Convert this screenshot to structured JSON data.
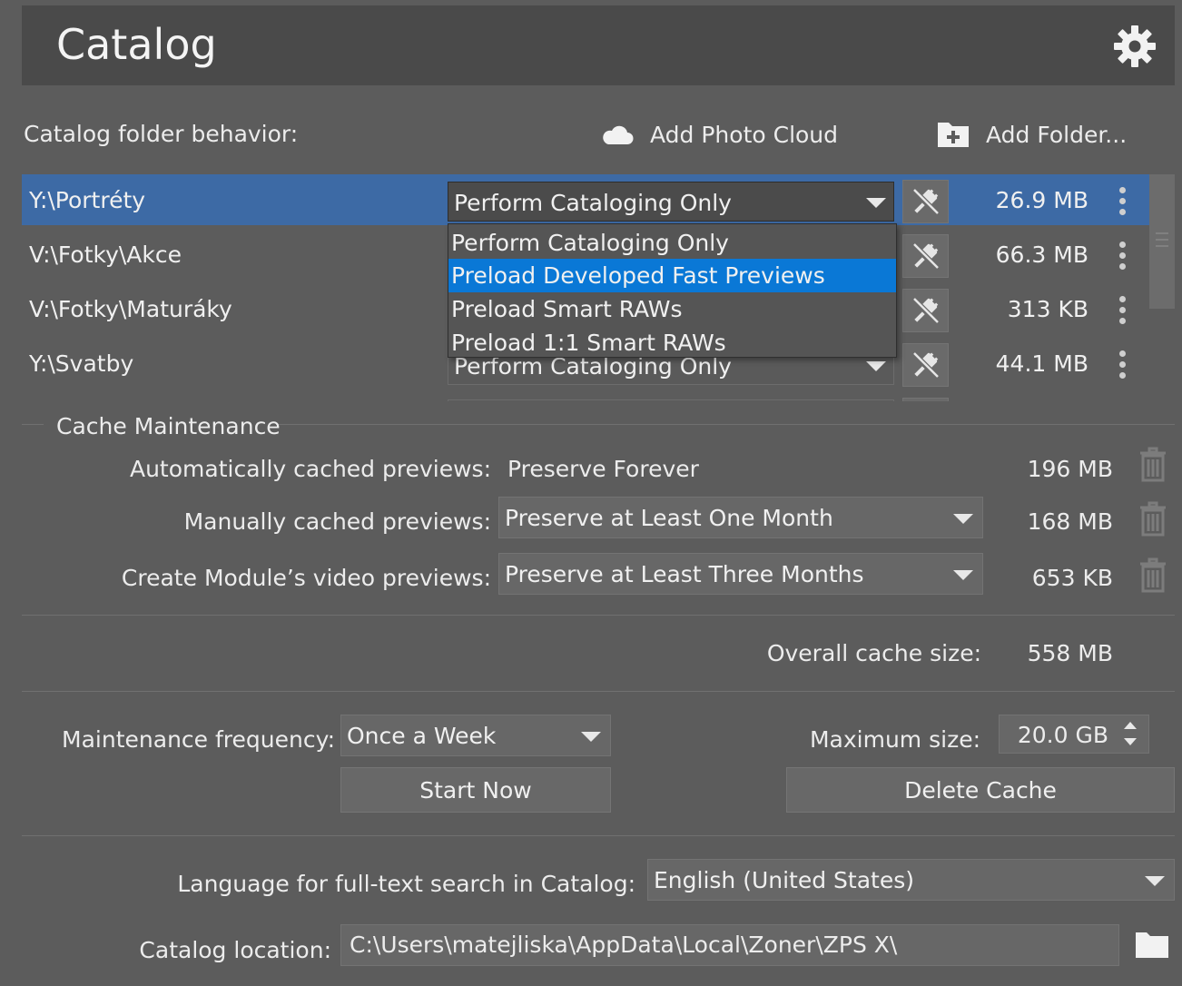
{
  "header": {
    "title": "Catalog",
    "settings_icon": "gear-icon"
  },
  "folders": {
    "behavior_label": "Catalog folder behavior:",
    "add_cloud_label": "Add Photo Cloud",
    "add_folder_label": "Add Folder...",
    "rows": [
      {
        "path": "Y:\\Portréty",
        "behavior": "Perform Cataloging Only",
        "size": "26.9 MB",
        "selected": true
      },
      {
        "path": "V:\\Fotky\\Akce",
        "behavior": "Perform Cataloging Only",
        "size": "66.3 MB",
        "selected": false
      },
      {
        "path": "V:\\Fotky\\Maturáky",
        "behavior": "Perform Cataloging Only",
        "size": "313 KB",
        "selected": false
      },
      {
        "path": "Y:\\Svatby",
        "behavior": "Perform Cataloging Only",
        "size": "44.1 MB",
        "selected": false
      }
    ],
    "dropdown_options": [
      "Perform Cataloging Only",
      "Preload Developed Fast Previews",
      "Preload Smart RAWs",
      "Preload 1:1 Smart RAWs"
    ],
    "dropdown_highlighted": "Preload Developed Fast Previews"
  },
  "cache": {
    "section_title": "Cache Maintenance",
    "auto_label": "Automatically cached previews:",
    "auto_value": "Preserve Forever",
    "auto_size": "196 MB",
    "manual_label": "Manually cached previews:",
    "manual_value": "Preserve at Least One Month",
    "manual_size": "168 MB",
    "video_label": "Create Module’s video previews:",
    "video_value": "Preserve at Least Three Months",
    "video_size": "653 KB",
    "overall_label": "Overall cache size:",
    "overall_value": "558 MB",
    "frequency_label": "Maintenance frequency:",
    "frequency_value": "Once a Week",
    "max_label": "Maximum size:",
    "max_value": "20.0 GB",
    "start_label": "Start Now",
    "delete_label": "Delete Cache"
  },
  "search": {
    "language_label": "Language for full-text search in Catalog:",
    "language_value": "English (United States)",
    "location_label": "Catalog location:",
    "location_value": "C:\\Users\\matejliska\\AppData\\Local\\Zoner\\ZPS X\\"
  },
  "colors": {
    "background": "#5c5c5c",
    "header": "#4a4a4a",
    "selected_row": "#3d6aa5",
    "highlight": "#0a78d6"
  }
}
